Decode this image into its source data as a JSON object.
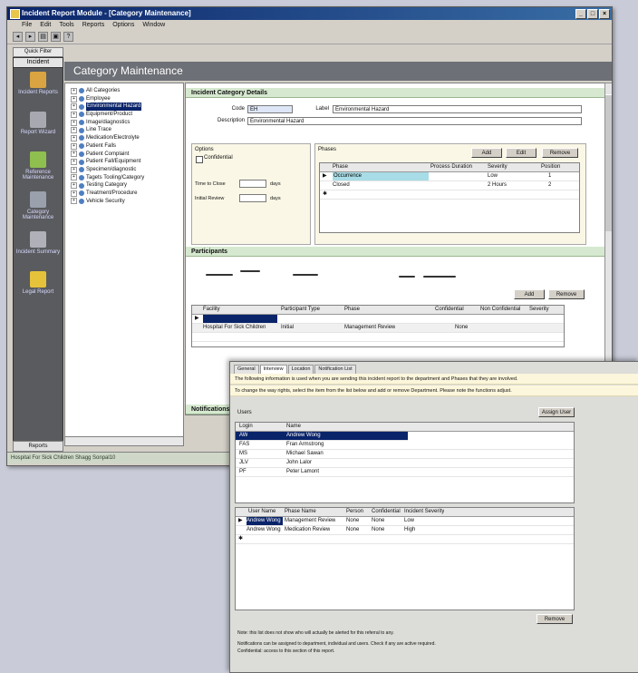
{
  "main": {
    "title": "Incident Report Module - [Category Maintenance]",
    "menu": [
      "File",
      "Edit",
      "Tools",
      "Reports",
      "Options",
      "Window"
    ],
    "nav_tab": "Quick Filter",
    "nav_header": "Incident",
    "nav_items": [
      "Incident Reports",
      "Report Wizard",
      "Reference Maintenance",
      "Category Maintenance",
      "Incident Summary",
      "Legal Report"
    ],
    "nav_footer": "Reports",
    "header": "Category Maintenance",
    "tree": [
      "All Categories",
      "Employee",
      "Environmental Hazard",
      "Equipment/Product",
      "Image/diagnostics",
      "Line Trace",
      "Medication/Electrolyte",
      "Patient Falls",
      "Patient Complaint",
      "Patient Fall/Equipment",
      "Specimen/diagnostic",
      "Tagets Tooling/Category",
      "Testing Category",
      "Treatment/Procedure",
      "Vehicle Security"
    ],
    "tree_selected_index": 2,
    "details": {
      "section": "Incident Category Details",
      "code_label": "Code",
      "code": "EH",
      "label_label": "Label",
      "label_value": "Environmental Hazard",
      "description_label": "Description",
      "description": "Environmental Hazard",
      "options_label": "Options",
      "confidential_label": "Confidential",
      "time_label": "Time to Close",
      "time_unit": "days",
      "initial_label": "Initial Review",
      "initial_unit": "days",
      "phases_label": "Phases",
      "buttons": [
        "Add",
        "Edit",
        "Remove"
      ],
      "phases_cols": [
        "Phase",
        "Process Duration",
        "Severity",
        "Position"
      ],
      "phases_rows": [
        [
          "Occurrence",
          "",
          "Low",
          "1"
        ],
        [
          "Closed",
          "",
          "2 Hours",
          "2"
        ]
      ]
    },
    "participants": {
      "section": "Participants",
      "buttons": [
        "Add",
        "Remove"
      ],
      "cols": [
        "Facility",
        "Participant Type",
        "Phase",
        "Confidential",
        "Non Confidential",
        "Severity"
      ],
      "rows": [
        [
          "",
          "",
          "",
          "",
          "",
          ""
        ],
        [
          "Hospital For Sick Children",
          "Initial",
          "Management Review",
          "",
          "None",
          ""
        ],
        [
          "",
          "",
          "",
          "",
          "",
          ""
        ]
      ]
    },
    "notifications": "Notifications",
    "status": "Hospital For Sick Children  Shagg Sonpal10"
  },
  "second": {
    "tabs": [
      "General",
      "Interview",
      "Location",
      "Notification List"
    ],
    "note1": "The following information is used when you are sending this incident report to the department and Phases that they are involved.",
    "note2": "To change the way rights, select the item from the list below and add or remove Department. Please note the functions adjust.",
    "users_label": "Users",
    "assign_button": "Assign User",
    "users_cols": [
      "Login",
      "Name"
    ],
    "users": [
      [
        "AW",
        "Andrew Wong"
      ],
      [
        "FAS",
        "Fran Armstrong"
      ],
      [
        "MS",
        "Michael Sawan"
      ],
      [
        "JLV",
        "John Lalor"
      ],
      [
        "PF",
        "Peter Lamont"
      ]
    ],
    "grid_cols": [
      "User Name",
      "Phase Name",
      "Person",
      "Confidential",
      "Incident Severity"
    ],
    "grid_rows": [
      [
        "Andrew Wong",
        "Management Review",
        "None",
        "None",
        "Low"
      ],
      [
        "Andrew Wong",
        "Medication Review",
        "None",
        "None",
        "High"
      ],
      [
        "",
        "",
        "",
        "",
        ""
      ]
    ],
    "remove_button": "Remove",
    "footer1": "Note: this list does not show who will actually be alerted for this referral to any.",
    "footer2": "Notifications can be assigned to department, individual and users. Check if any are active required.",
    "footer3": "Confidential: access to this section of this report."
  }
}
